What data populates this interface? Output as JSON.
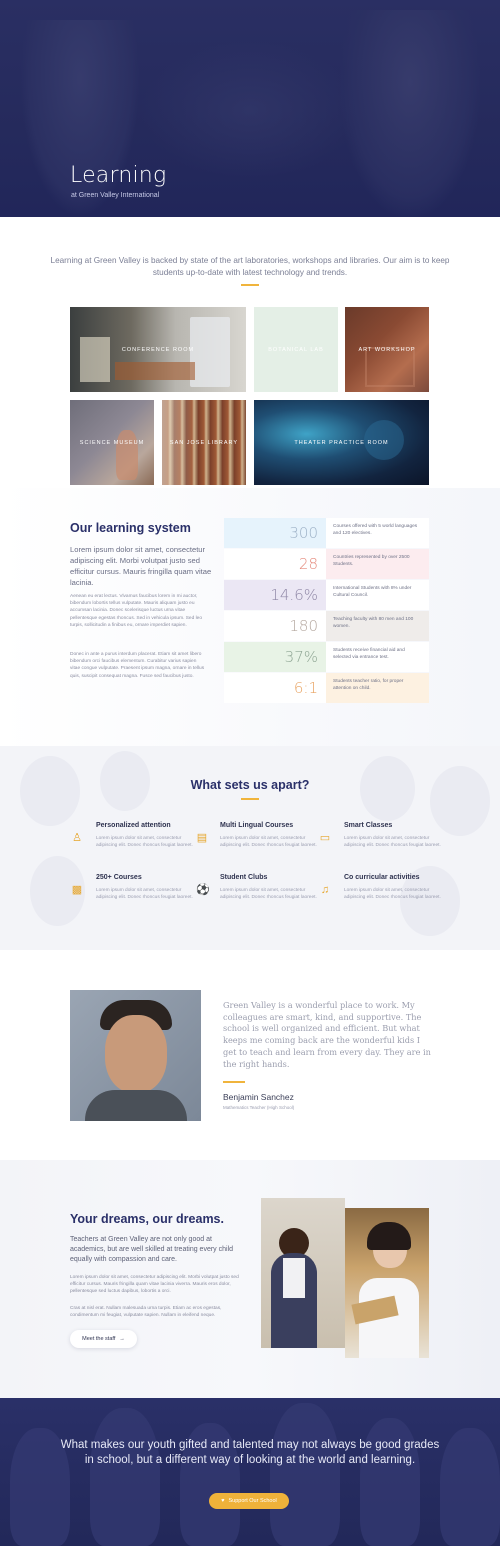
{
  "hero": {
    "title": "Learning",
    "subtitle": "at Green Valley International"
  },
  "intro": {
    "text": "Learning at Green Valley is backed by state of the art laboratories, workshops and libraries. Our aim is to keep students up-to-date with latest technology and trends."
  },
  "tiles": [
    {
      "label": "Conference Room"
    },
    {
      "label": "Botanical Lab"
    },
    {
      "label": "Art Workshop"
    },
    {
      "label": "Science Museum"
    },
    {
      "label": "San Jose Library"
    },
    {
      "label": "Theater Practice Room"
    }
  ],
  "system": {
    "title": "Our learning system",
    "lead": "Lorem ipsum dolor sit amet, consectetur adipiscing elit. Morbi volutpat justo sed efficitur cursus. Mauris fringilla quam vitae lacinia.",
    "p1": "Aenean eu erat lectus. Vivamus faucibus lorem in mi auctor, bibendum lobortis tellus vulputate. Mauris aliquam justo eu accumsan lacinia. Donec scelerisque luctus urna vitae pellentesque egestas rhoncus. Sed in vehicula ipsum. Sed leo turpis, sollicitudin a finibus eu, ornare imperdiet sapien.",
    "p2": "Donec in ante a purus interdum placerat. Etiam sit amet libero bibendum orci faucibus elementum. Curabitur varius sapien vitae congue vulputate. Praesent ipsum magna, ornare in tellus quis, suscipit consequat magna. Fusce sed faucibus justo.",
    "stats": [
      {
        "value": "300",
        "text": "Courses offered with 5 world languages and 120 electives.",
        "color": "#9fb3c8",
        "bg": "#e6f3fc",
        "bg2": "#ffffff"
      },
      {
        "value": "28",
        "text": "Countries represented by over 2500 Students.",
        "color": "#e58a7c",
        "bg": "#ffffff",
        "bg2": "#fcecef"
      },
      {
        "value": "14.6%",
        "text": "International Students with 8% under Cultural Council.",
        "color": "#8f87a6",
        "bg": "#ebe7f4",
        "bg2": "#ffffff"
      },
      {
        "value": "180",
        "text": "Teaching faculty with 80 men and 100 women.",
        "color": "#b5a8a0",
        "bg": "#ffffff",
        "bg2": "#efecea"
      },
      {
        "value": "37%",
        "text": "Students receive financial aid and selected via entrance test.",
        "color": "#8fa694",
        "bg": "#e8f3e6",
        "bg2": "#ffffff"
      },
      {
        "value": "6:1",
        "text": "Students teacher ratio, for proper attention on child.",
        "color": "#e8a361",
        "bg": "#ffffff",
        "bg2": "#fdf1e1"
      }
    ]
  },
  "apart": {
    "title": "What sets us apart?",
    "features": [
      {
        "title": "Personalized attention",
        "desc": "Lorem ipsum dolor sit amet, consectetur adipiscing elit. Donec rhoncus feugiat laoreet.",
        "icon": "person-icon"
      },
      {
        "title": "Multi Lingual Courses",
        "desc": "Lorem ipsum dolor sit amet, consectetur adipiscing elit. Donec rhoncus feugiat laoreet.",
        "icon": "translate-icon"
      },
      {
        "title": "Smart Classes",
        "desc": "Lorem ipsum dolor sit amet, consectetur adipiscing elit. Donec rhoncus feugiat laoreet.",
        "icon": "laptop-icon"
      },
      {
        "title": "250+ Courses",
        "desc": "Lorem ipsum dolor sit amet, consectetur adipiscing elit. Donec rhoncus feugiat laoreet.",
        "icon": "book-icon"
      },
      {
        "title": "Student Clubs",
        "desc": "Lorem ipsum dolor sit amet, consectetur adipiscing elit. Donec rhoncus feugiat laoreet.",
        "icon": "soccer-ball-icon"
      },
      {
        "title": "Co curricular activities",
        "desc": "Lorem ipsum dolor sit amet, consectetur adipiscing elit. Donec rhoncus feugiat laoreet.",
        "icon": "music-note-icon"
      }
    ]
  },
  "testimonial": {
    "quote": "Green Valley is a wonderful place to work. My colleagues are smart, kind, and supportive. The school is well organized and efficient. But what keeps me coming back are the wonderful kids I get to teach and learn from every day. They are in the right hands.",
    "name": "Benjamin Sanchez",
    "role": "Mathematics Teacher (High School)"
  },
  "dreams": {
    "title": "Your dreams, our dreams.",
    "lead": "Teachers at Green Valley are not only good at academics, but are well skilled at treating every child equally with compassion and care.",
    "p1": "Lorem ipsum dolor sit amet, consectetur adipiscing elit. Morbi volutpat justo sed efficitur cursus. Mauris fringilla quam vitae lacinia viverra. Mauris eros dolor, pellentesque sed luctus dapibus, lobortis a orci.",
    "p2": "Cras at nisl erat. Nullam malesuada urna turpis. Etiam ac eros egestas, condimentum mi feugiat, vulputate sapien. Nullam in eleifend neque.",
    "button": "Meet the staff"
  },
  "footer": {
    "text": "What makes our youth gifted and talented may not always be good grades in school, but a different way of looking at the world and learning.",
    "button": "Support Our School"
  },
  "colors": {
    "navy": "#2a3069",
    "accent": "#f0b43c"
  }
}
